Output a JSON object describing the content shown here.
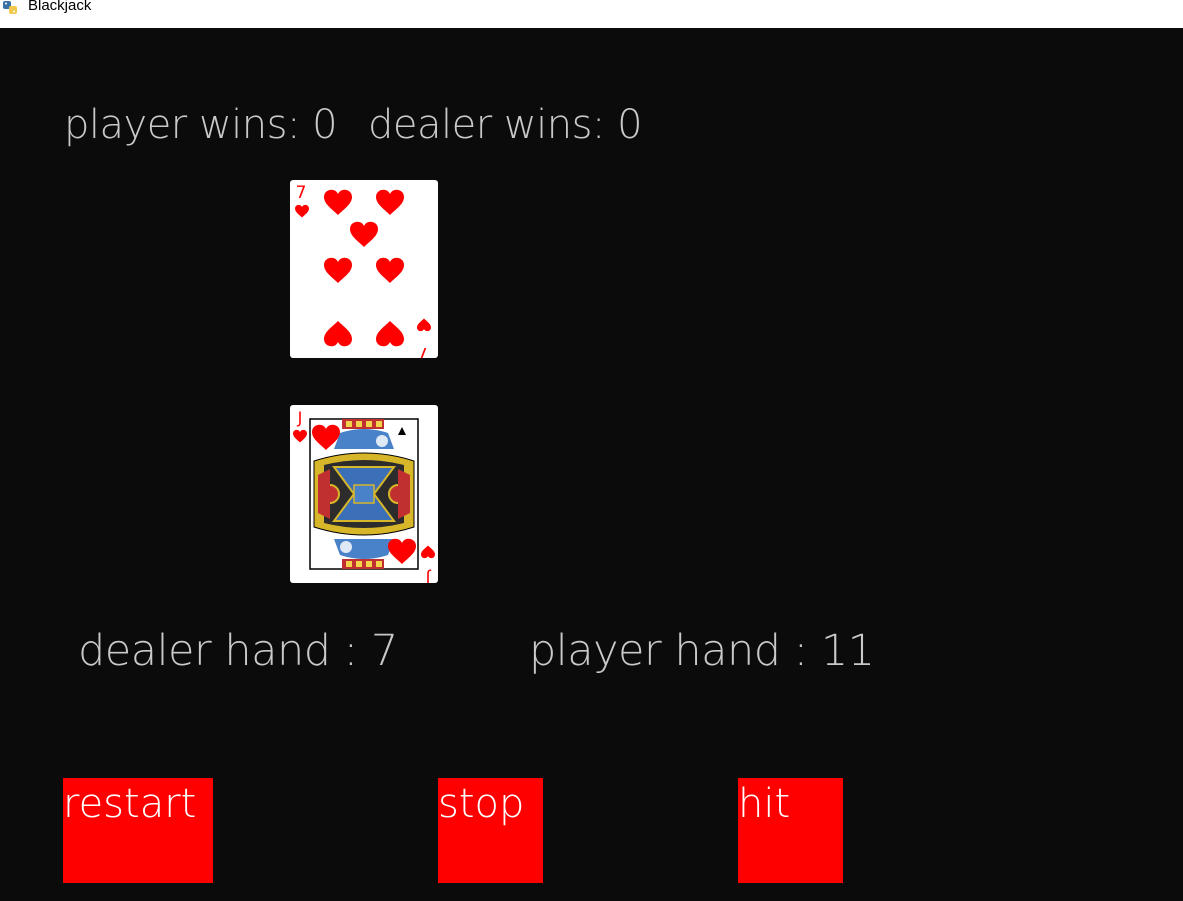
{
  "window": {
    "title": "Blackjack",
    "icon": "python-icon"
  },
  "scores": {
    "player_wins": "player wins: 0",
    "dealer_wins": "dealer wins: 0"
  },
  "cards": {
    "dealer_card": {
      "rank": "7",
      "suit": "hearts"
    },
    "player_card": {
      "rank": "J",
      "suit": "hearts"
    }
  },
  "hands": {
    "dealer_hand": "dealer hand : 7",
    "player_hand": "player hand : 11"
  },
  "buttons": {
    "restart": "restart",
    "stop": "stop",
    "hit": "hit"
  },
  "colors": {
    "background": "#0b0b0b",
    "button": "#ff0000",
    "text": "#c9c9c9",
    "suit_red": "#ff0000"
  }
}
